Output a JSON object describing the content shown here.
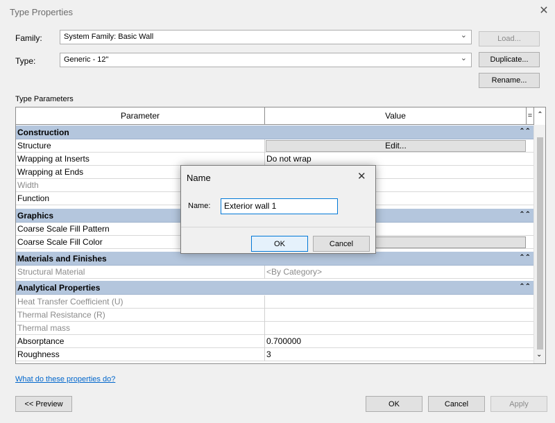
{
  "window": {
    "title": "Type Properties"
  },
  "family": {
    "label": "Family:",
    "value": "System Family: Basic Wall",
    "button": "Load..."
  },
  "type": {
    "label": "Type:",
    "value": "Generic - 12\"",
    "duplicate": "Duplicate...",
    "rename": "Rename..."
  },
  "section": {
    "label": "Type Parameters"
  },
  "grid": {
    "col_parameter": "Parameter",
    "col_value": "Value",
    "col_equals": "=",
    "categories": {
      "construction": "Construction",
      "graphics": "Graphics",
      "materials": "Materials and Finishes",
      "analytical": "Analytical Properties"
    },
    "rows": {
      "structure": {
        "p": "Structure",
        "v": "Edit..."
      },
      "wrap_inserts": {
        "p": "Wrapping at Inserts",
        "v": "Do not wrap"
      },
      "wrap_ends": {
        "p": "Wrapping at Ends",
        "v": ""
      },
      "width": {
        "p": "Width",
        "v": ""
      },
      "function": {
        "p": "Function",
        "v": ""
      },
      "fill_pattern": {
        "p": "Coarse Scale Fill Pattern",
        "v": ""
      },
      "fill_color": {
        "p": "Coarse Scale Fill Color",
        "v": ""
      },
      "struct_material": {
        "p": "Structural Material",
        "v": "<By Category>"
      },
      "heat": {
        "p": "Heat Transfer Coefficient (U)",
        "v": ""
      },
      "resistance": {
        "p": "Thermal Resistance (R)",
        "v": ""
      },
      "mass": {
        "p": "Thermal mass",
        "v": ""
      },
      "absorptance": {
        "p": "Absorptance",
        "v": "0.700000"
      },
      "roughness": {
        "p": "Roughness",
        "v": "3"
      }
    }
  },
  "help_link": "What do these properties do?",
  "footer": {
    "preview": "<< Preview",
    "ok": "OK",
    "cancel": "Cancel",
    "apply": "Apply"
  },
  "name_dialog": {
    "title": "Name",
    "label": "Name:",
    "value": "Exterior wall 1",
    "ok": "OK",
    "cancel": "Cancel"
  },
  "colors": {
    "category_band": "#b4c6dd",
    "link": "#0066cc",
    "focus": "#0078d7"
  }
}
